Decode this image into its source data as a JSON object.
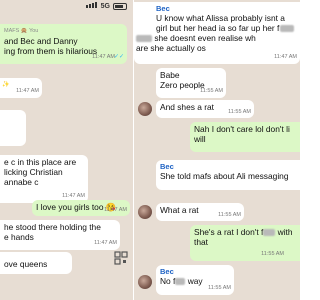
{
  "status_bar": {
    "network": "5G"
  },
  "left": {
    "top_sender_partial": "MAFS 🙊 You",
    "top_msg_partial": "and Bec and Danny",
    "msg1_partial": "ing from them is hilarious",
    "msg1_time": "11:47 AM",
    "msg2_time": "11:47 AM",
    "msg3_lines": [
      "e c in this place are",
      "licking Christian",
      "annabe c"
    ],
    "msg3_time": "11:47 AM",
    "msg4": "I love you girls too 😘",
    "msg4_time": "11:47 AM",
    "msg5_lines": [
      "he stood there holding the",
      "e hands"
    ],
    "msg5_time": "11:47 AM",
    "msg6_partial": "ove queens"
  },
  "right": {
    "msg1_sender": "Bec",
    "msg1_lines": [
      "U know what Alissa probably isnt a",
      "girl but her head ia so far up her f",
      "she doesnt even realise wh",
      "are she actually os"
    ],
    "msg1_time": "11:47 AM",
    "msg2_lines": [
      "Babe",
      "Zero people"
    ],
    "msg2_time": "11:55 AM",
    "msg3": "And shes a rat",
    "msg3_time": "11:55 AM",
    "msg4_lines": [
      "Nah I don't care lol don't li",
      "will"
    ],
    "msg4_time": "11:55 AM",
    "msg5_sender": "Bec",
    "msg5": "She told mafs about Ali messaging",
    "msg5_time": "11:55 AM",
    "msg6": "What a rat",
    "msg6_time": "11:55 AM",
    "msg7_lines": [
      "She's a rat I don't f",
      "with",
      "that"
    ],
    "msg7_time": "11:55 AM",
    "msg8_sender": "Bec",
    "msg8_prefix": "No f",
    "msg8_suffix": " way",
    "msg8_time": "11:55 AM"
  }
}
